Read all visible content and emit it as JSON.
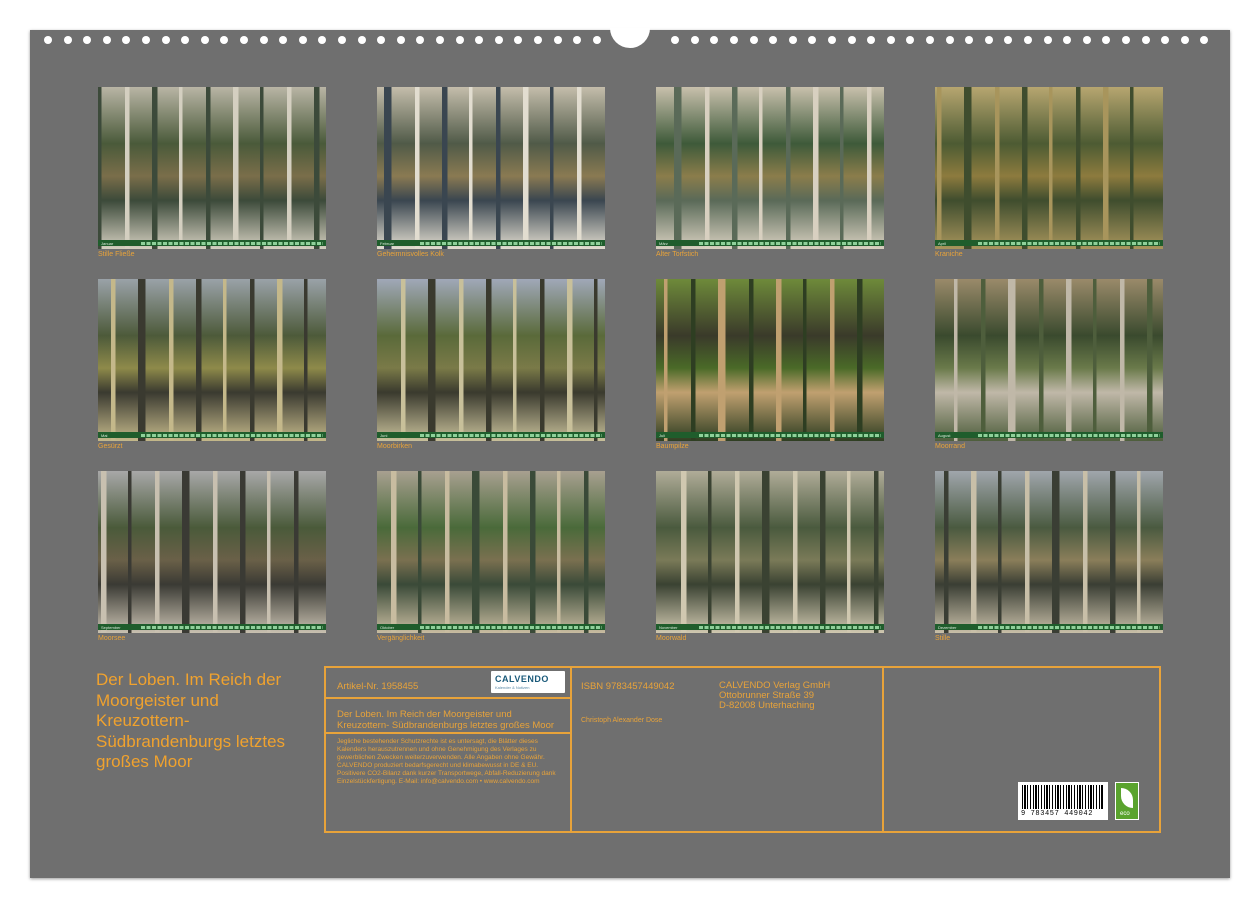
{
  "months": [
    {
      "caption": "Stille Fließe",
      "month": "Januar",
      "palette": [
        "#7a6e4a",
        "#4a5a3a",
        "#b9b5a5",
        "#3c4a3a",
        "#d4cfc0"
      ]
    },
    {
      "caption": "Geheimnisvolles Kolk",
      "month": "Februar",
      "palette": [
        "#8a7a52",
        "#505a48",
        "#c4bdab",
        "#3a4650",
        "#e2ddd0"
      ]
    },
    {
      "caption": "Alter Torfstich",
      "month": "März",
      "palette": [
        "#8b7d4b",
        "#3e5a3a",
        "#c8c0ac",
        "#5a6a58",
        "#d8d0c0"
      ]
    },
    {
      "caption": "Kraniche",
      "month": "April",
      "palette": [
        "#8d7b3e",
        "#4d5b33",
        "#b7a670",
        "#3f4d2e",
        "#a8955c"
      ]
    },
    {
      "caption": "Gesürzt",
      "month": "Mai",
      "palette": [
        "#8e8a4a",
        "#4d5a3a",
        "#9aa2a8",
        "#3a3a30",
        "#c4b88a"
      ]
    },
    {
      "caption": "Moorbirken",
      "month": "Juni",
      "palette": [
        "#7a7a48",
        "#5a6a3a",
        "#a0a8b8",
        "#3a3a2e",
        "#c8c09a"
      ]
    },
    {
      "caption": "Baumpilze",
      "month": "Juli",
      "palette": [
        "#4a6a28",
        "#3a3a2a",
        "#6e8a3a",
        "#c0a070",
        "#2e3e22"
      ]
    },
    {
      "caption": "Moorrand",
      "month": "August",
      "palette": [
        "#6a7a4a",
        "#3a4a2e",
        "#9a8a6a",
        "#c0b8a8",
        "#4e5e3c"
      ]
    },
    {
      "caption": "Moorsee",
      "month": "September",
      "palette": [
        "#6a6048",
        "#4a5a3a",
        "#a8a8a8",
        "#3a3a34",
        "#c8c0b0"
      ]
    },
    {
      "caption": "Vergänglichkeit",
      "month": "Oktober",
      "palette": [
        "#7a7050",
        "#4a6a3a",
        "#a8a090",
        "#3a4a38",
        "#c8bca0"
      ]
    },
    {
      "caption": "Moorwald",
      "month": "November",
      "palette": [
        "#7a7a58",
        "#4a5a3e",
        "#b0ac98",
        "#3a4232",
        "#d0c8b0"
      ]
    },
    {
      "caption": "Stille",
      "month": "Dezember",
      "palette": [
        "#8a7e5a",
        "#4a5a40",
        "#a0a6ac",
        "#3a3e34",
        "#c8bfa8"
      ]
    }
  ],
  "title": "Der Loben. Im Reich der Moorgeister und Kreuzottern- Südbrandenburgs letztes großes Moor",
  "article": "Artikel-Nr. 1958455",
  "logo": {
    "brand": "CALVENDO",
    "tagline": "Kalender & Notizen"
  },
  "product_title": "Der Loben. Im Reich der Moorgeister und Kreuzottern- Südbrandenburgs letztes großes Moor",
  "legal": "Jegliche bestehender Schutzrechte ist es untersagt, die Blätter dieses Kalenders herauszutrennen und ohne Genehmigung des Verlages zu gewerblichen Zwecken weiterzuverwenden. Alle Angaben ohne Gewähr. CALVENDO produziert bedarfsgerecht und klimabewusst in DE & EU. Positivere CO2-Bilanz dank kurzer Transportwege, Abfall-Reduzierung dank Einzelstückfertigung. E-Mail: info@calvendo.com • www.calvendo.com",
  "isbn": "ISBN 9783457449042",
  "author": "Christoph Alexander Dose",
  "publisher": [
    "CALVENDO Verlag GmbH",
    "Ottobrunner Straße 39",
    "D-82008 Unterhaching"
  ],
  "barcode_number": "9 783457 449042",
  "eco_label": "eco",
  "colors": {
    "background": "#6f6f6f",
    "accent": "#e8a33a",
    "strip": "#1f5d2c"
  }
}
